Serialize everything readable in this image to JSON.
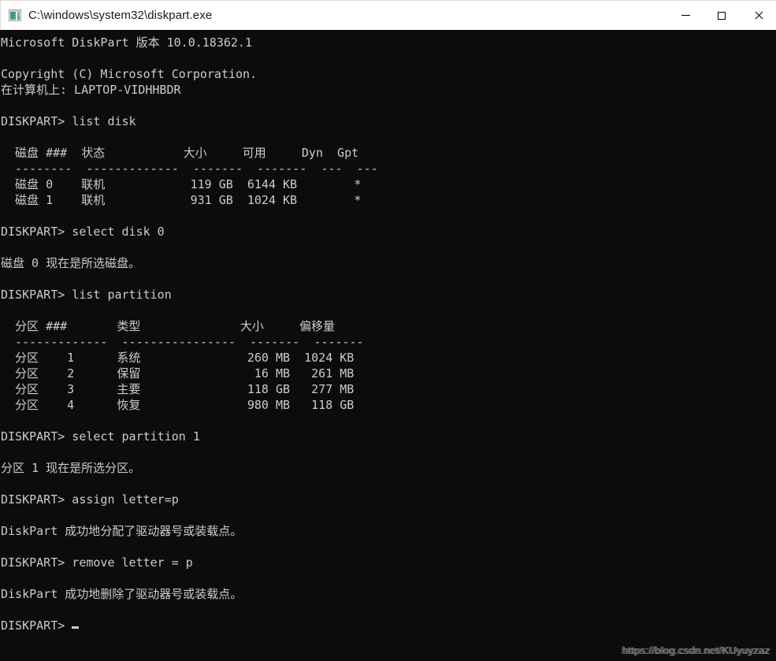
{
  "window": {
    "title": "C:\\windows\\system32\\diskpart.exe",
    "icon": "console-window-icon",
    "controls": {
      "minimize": "—",
      "maximize": "□",
      "close": "✕"
    },
    "titlebar_bg": "#ffffff",
    "console_bg": "#0c0c0c",
    "console_fg": "#cccccc"
  },
  "console": {
    "lines": [
      "Microsoft DiskPart 版本 10.0.18362.1",
      "",
      "Copyright (C) Microsoft Corporation.",
      "在计算机上: LAPTOP-VIDHHBDR",
      "",
      "DISKPART> list disk",
      "",
      "  磁盘 ###  状态           大小     可用     Dyn  Gpt",
      "  --------  -------------  -------  -------  ---  ---",
      "  磁盘 0    联机            119 GB  6144 KB        *",
      "  磁盘 1    联机            931 GB  1024 KB        *",
      "",
      "DISKPART> select disk 0",
      "",
      "磁盘 0 现在是所选磁盘。",
      "",
      "DISKPART> list partition",
      "",
      "  分区 ###       类型              大小     偏移量",
      "  -------------  ----------------  -------  -------",
      "  分区    1      系统               260 MB  1024 KB",
      "  分区    2      保留                16 MB   261 MB",
      "  分区    3      主要               118 GB   277 MB",
      "  分区    4      恢复               980 MB   118 GB",
      "",
      "DISKPART> select partition 1",
      "",
      "分区 1 现在是所选分区。",
      "",
      "DISKPART> assign letter=p",
      "",
      "DiskPart 成功地分配了驱动器号或装载点。",
      "",
      "DISKPART> remove letter = p",
      "",
      "DiskPart 成功地删除了驱动器号或装载点。",
      "",
      "DISKPART> "
    ],
    "prompt": "DISKPART> ",
    "cursor": "_"
  },
  "disk_table": {
    "headers": [
      "磁盘 ###",
      "状态",
      "大小",
      "可用",
      "Dyn",
      "Gpt"
    ],
    "rows": [
      {
        "id": "磁盘 0",
        "status": "联机",
        "size": "119 GB",
        "free": "6144 KB",
        "dyn": "",
        "gpt": "*"
      },
      {
        "id": "磁盘 1",
        "status": "联机",
        "size": "931 GB",
        "free": "1024 KB",
        "dyn": "",
        "gpt": "*"
      }
    ]
  },
  "partition_table": {
    "headers": [
      "分区 ###",
      "类型",
      "大小",
      "偏移量"
    ],
    "rows": [
      {
        "id": "分区    1",
        "type": "系统",
        "size": "260 MB",
        "offset": "1024 KB"
      },
      {
        "id": "分区    2",
        "type": "保留",
        "size": "16 MB",
        "offset": "261 MB"
      },
      {
        "id": "分区    3",
        "type": "主要",
        "size": "118 GB",
        "offset": "277 MB"
      },
      {
        "id": "分区    4",
        "type": "恢复",
        "size": "980 MB",
        "offset": "118 GB"
      }
    ]
  },
  "commands": [
    "list disk",
    "select disk 0",
    "list partition",
    "select partition 1",
    "assign letter=p",
    "remove letter = p"
  ],
  "messages": [
    "磁盘 0 现在是所选磁盘。",
    "分区 1 现在是所选分区。",
    "DiskPart 成功地分配了驱动器号或装载点。",
    "DiskPart 成功地删除了驱动器号或装载点。"
  ],
  "watermark": {
    "text": "https://blog.csdn.net/KUyuyzaz"
  }
}
